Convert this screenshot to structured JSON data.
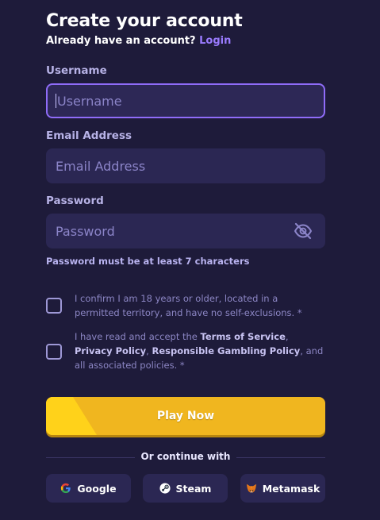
{
  "header": {
    "title": "Create your account",
    "subtitle_prefix": "Already have an account?",
    "login_link": "Login"
  },
  "form": {
    "username": {
      "label": "Username",
      "placeholder": "Username"
    },
    "email": {
      "label": "Email Address",
      "placeholder": "Email Address"
    },
    "password": {
      "label": "Password",
      "placeholder": "Password",
      "hint": "Password must be at least 7 characters"
    }
  },
  "consents": {
    "age": {
      "text": "I confirm I am 18 years or older, located in a permitted territory, and have no self-exclusions. *"
    },
    "policies": {
      "prefix": "I have read and accept the ",
      "terms": "Terms of Service",
      "sep1": ", ",
      "privacy": "Privacy Policy",
      "sep2": ", ",
      "gambling": "Responsible Gambling Policy",
      "suffix": ", and all associated policies. *"
    }
  },
  "actions": {
    "play_label": "Play Now",
    "divider_text": "Or continue with",
    "social": [
      {
        "label": "Google",
        "icon": "google-icon"
      },
      {
        "label": "Steam",
        "icon": "steam-icon"
      },
      {
        "label": "Metamask",
        "icon": "metamask-icon"
      }
    ]
  },
  "colors": {
    "background": "#1e1b3a",
    "field": "#2b2753",
    "accent": "#8f6cf8",
    "primary_button": "#f0b61f"
  }
}
